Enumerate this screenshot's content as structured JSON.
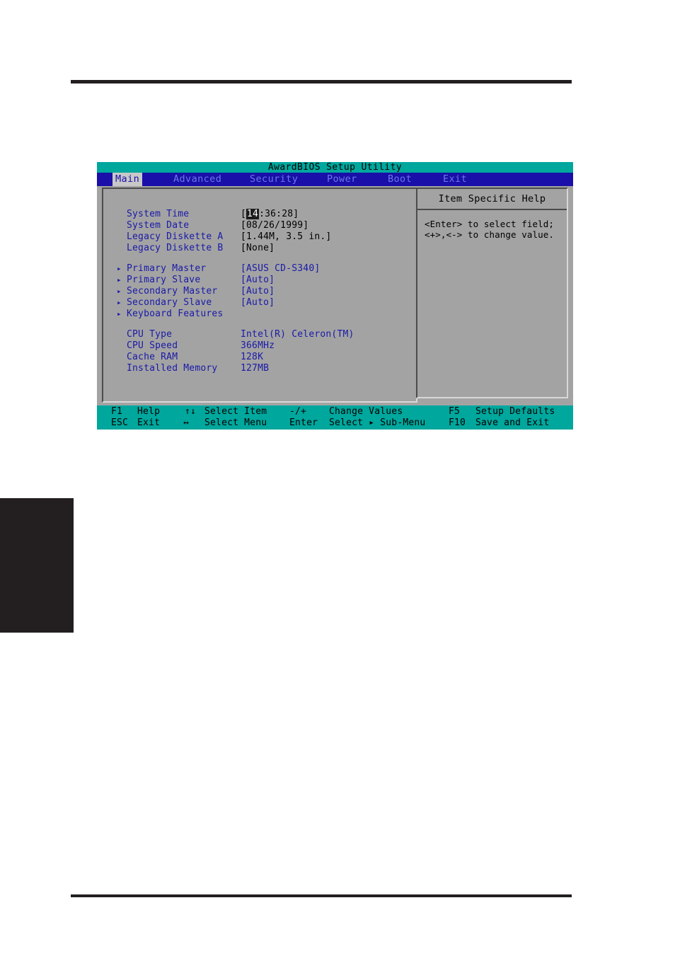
{
  "bios": {
    "title": "AwardBIOS Setup Utility",
    "menu": [
      {
        "label": "Main",
        "active": true
      },
      {
        "label": "Advanced",
        "active": false
      },
      {
        "label": "Security",
        "active": false
      },
      {
        "label": "Power",
        "active": false
      },
      {
        "label": "Boot",
        "active": false
      },
      {
        "label": "Exit",
        "active": false
      }
    ],
    "settings": [
      {
        "label": "System Time",
        "value_pre": "[",
        "value_hl": "14",
        "value_post": ":36:28]"
      },
      {
        "label": "System Date",
        "value": "[08/26/1999]"
      },
      {
        "label": "Legacy Diskette A",
        "value": "[1.44M, 3.5 in.]"
      },
      {
        "label": "Legacy Diskette B",
        "value": "[None]"
      }
    ],
    "submenus": [
      {
        "bullet": "▸",
        "label": "Primary Master",
        "value": "[ASUS CD-S340]"
      },
      {
        "bullet": "▸",
        "label": "Primary Slave",
        "value": "[Auto]"
      },
      {
        "bullet": "▸",
        "label": "Secondary Master",
        "value": "[Auto]"
      },
      {
        "bullet": "▸",
        "label": "Secondary Slave",
        "value": "[Auto]"
      },
      {
        "bullet": "▸",
        "label": "Keyboard Features",
        "value": ""
      }
    ],
    "sysinfo": [
      {
        "label": "CPU Type",
        "value": "Intel(R) Celeron(TM)"
      },
      {
        "label": "CPU Speed",
        "value": "366MHz"
      },
      {
        "label": "Cache RAM",
        "value": "128K"
      },
      {
        "label": "Installed Memory",
        "value": "127MB"
      }
    ],
    "help": {
      "title": "Item Specific Help",
      "line1": "<Enter> to select field;",
      "line2": "<+>,<-> to change value."
    },
    "function_keys": {
      "row1": [
        {
          "key": "F1",
          "desc": "Help"
        },
        {
          "key": "↑↓",
          "desc": "Select Item"
        },
        {
          "key": "-/+",
          "desc": "Change Values"
        },
        {
          "key": "F5",
          "desc": "Setup Defaults"
        }
      ],
      "row2": [
        {
          "key": "ESC",
          "desc": "Exit"
        },
        {
          "key": "↔",
          "desc": "Select Menu"
        },
        {
          "key": "Enter",
          "desc": "Select ▸ Sub-Menu"
        },
        {
          "key": "F10",
          "desc": "Save and Exit"
        }
      ]
    },
    "colors": {
      "titlebar": "#00a79d",
      "menubar": "#1a0fa8",
      "panel": "#a3a3a3",
      "label_blue": "#1a1aa8",
      "footer": "#00a79d",
      "rule": "#231f20"
    }
  }
}
